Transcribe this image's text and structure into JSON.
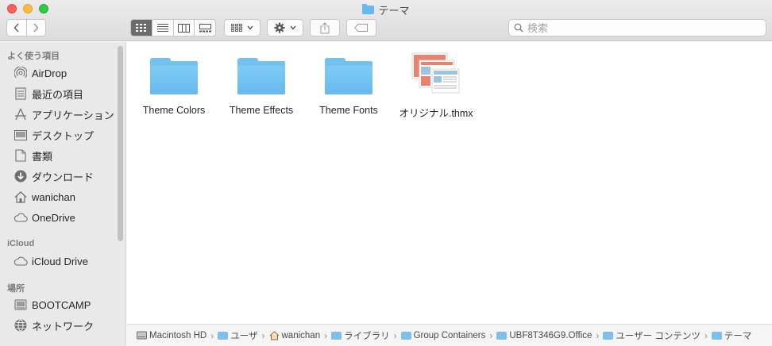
{
  "window": {
    "title": "テーマ"
  },
  "toolbar": {
    "back_icon": "chevron-left-icon",
    "forward_icon": "chevron-right-icon",
    "views": [
      "icon-view",
      "list-view",
      "column-view",
      "gallery-view"
    ],
    "active_view": "icon-view",
    "group_icon": "grid-icon",
    "action_icon": "gear-icon",
    "share_icon": "share-icon",
    "tag_icon": "tag-icon"
  },
  "search": {
    "placeholder": "検索",
    "value": ""
  },
  "sidebar": {
    "sections": [
      {
        "title": "よく使う項目"
      },
      {
        "title": "iCloud"
      },
      {
        "title": "場所"
      }
    ],
    "favorites": [
      {
        "label": "AirDrop",
        "icon": "airdrop-icon"
      },
      {
        "label": "最近の項目",
        "icon": "recents-icon"
      },
      {
        "label": "アプリケーション",
        "icon": "applications-icon"
      },
      {
        "label": "デスクトップ",
        "icon": "desktop-icon"
      },
      {
        "label": "書類",
        "icon": "documents-icon"
      },
      {
        "label": "ダウンロード",
        "icon": "downloads-icon"
      },
      {
        "label": "wanichan",
        "icon": "home-icon"
      },
      {
        "label": "OneDrive",
        "icon": "cloud-icon"
      }
    ],
    "icloud": [
      {
        "label": "iCloud Drive",
        "icon": "cloud-icon"
      }
    ],
    "locations": [
      {
        "label": "BOOTCAMP",
        "icon": "drive-icon"
      },
      {
        "label": "ネットワーク",
        "icon": "network-icon"
      }
    ]
  },
  "files": [
    {
      "name": "Theme Colors",
      "kind": "folder"
    },
    {
      "name": "Theme Effects",
      "kind": "folder"
    },
    {
      "name": "Theme Fonts",
      "kind": "folder"
    },
    {
      "name": "オリジナル.thmx",
      "kind": "thmx"
    }
  ],
  "pathbar": [
    {
      "label": "Macintosh HD",
      "icon": "hard-drive-icon"
    },
    {
      "label": "ユーザ",
      "icon": "folder-icon"
    },
    {
      "label": "wanichan",
      "icon": "home-icon"
    },
    {
      "label": "ライブラリ",
      "icon": "folder-icon"
    },
    {
      "label": "Group Containers",
      "icon": "folder-icon"
    },
    {
      "label": "UBF8T346G9.Office",
      "icon": "folder-icon"
    },
    {
      "label": "ユーザー コンテンツ",
      "icon": "folder-icon"
    },
    {
      "label": "テーマ",
      "icon": "folder-icon"
    }
  ],
  "colors": {
    "folder": "#74c0ef",
    "sidebar_bg": "#e9e9e9",
    "toolbar_bg": "#dcdcdc",
    "thmx_accent": "#e9836f"
  }
}
